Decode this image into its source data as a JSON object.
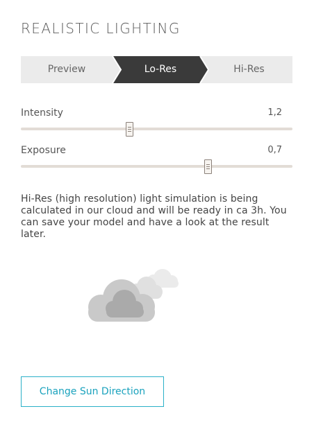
{
  "panel": {
    "title": "REALISTIC LIGHTING"
  },
  "resolution_tabs": [
    {
      "label": "Preview",
      "active": false
    },
    {
      "label": "Lo-Res",
      "active": true
    },
    {
      "label": "Hi-Res",
      "active": false
    }
  ],
  "sliders": {
    "intensity": {
      "label": "Intensity",
      "value": "1,2",
      "position_fraction": 0.4
    },
    "exposure": {
      "label": "Exposure",
      "value": "0,7",
      "position_fraction": 0.69
    }
  },
  "info_text": "Hi-Res (high resolution) light simulation is being calculated in our cloud and will be ready in ca 3h. You can save your model and have a look at the result later.",
  "illustration": {
    "icon": "cloud-computing-icon"
  },
  "actions": {
    "change_sun_label": "Change Sun Direction"
  },
  "colors": {
    "active_tab": "#3a3a3a",
    "inactive_tab": "#ebebeb",
    "accent": "#1aa2bd",
    "track": "#e2dcd6"
  }
}
